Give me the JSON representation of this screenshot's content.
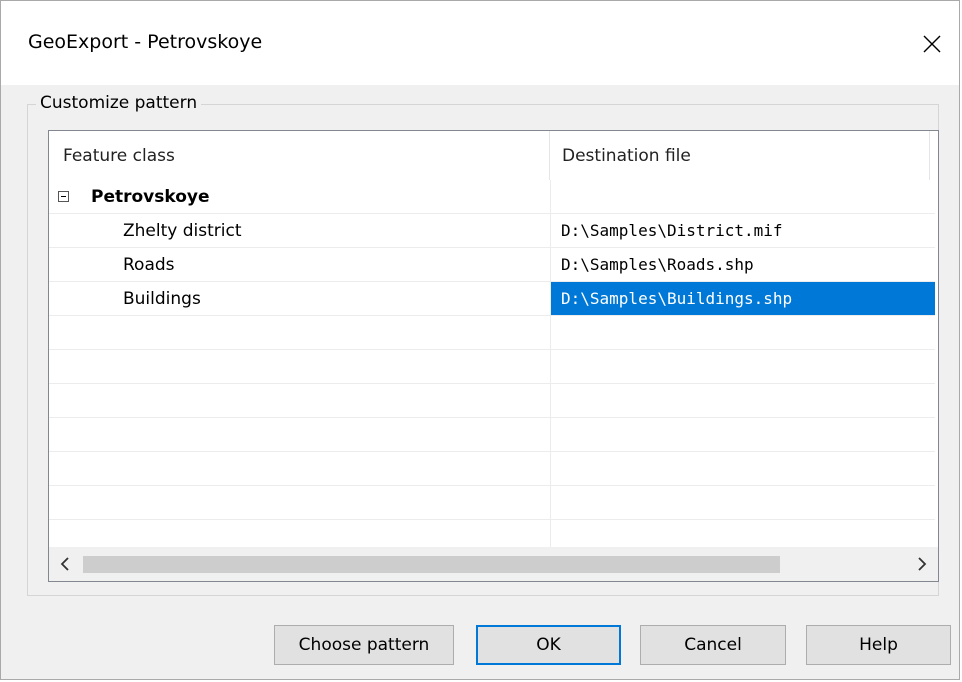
{
  "window": {
    "title": "GeoExport - Petrovskoye"
  },
  "group": {
    "label": "Customize pattern"
  },
  "table": {
    "columns": [
      "Feature class",
      "Destination file"
    ],
    "group_row": {
      "name": "Petrovskoye",
      "expanded": true
    },
    "rows": [
      {
        "feature": "Zhelty district",
        "destination": "D:\\Samples\\District.mif",
        "selected": false
      },
      {
        "feature": "Roads",
        "destination": "D:\\Samples\\Roads.shp",
        "selected": false
      },
      {
        "feature": "Buildings",
        "destination": "D:\\Samples\\Buildings.shp",
        "selected": true
      }
    ]
  },
  "buttons": {
    "choose_pattern": "Choose pattern",
    "ok": "OK",
    "cancel": "Cancel",
    "help": "Help"
  },
  "icons": {
    "close": "close-icon",
    "collapse": "minus-box-icon",
    "scroll_left": "chevron-left-icon",
    "scroll_right": "chevron-right-icon"
  },
  "colors": {
    "selection": "#0078d7",
    "default_button_border": "#0078d7"
  }
}
